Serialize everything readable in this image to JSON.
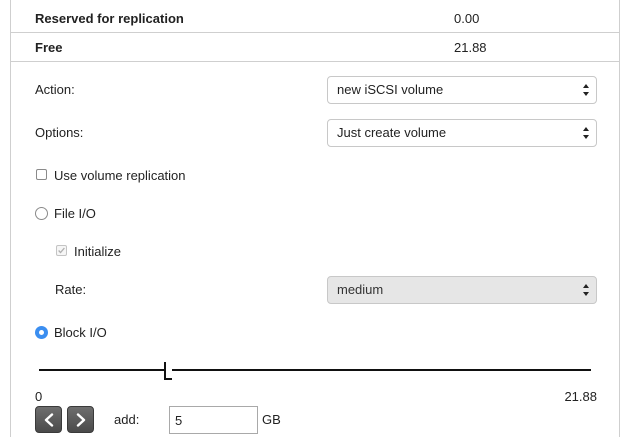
{
  "summary": {
    "reserved_label": "Reserved for replication",
    "reserved_value": "0.00",
    "free_label": "Free",
    "free_value": "21.88"
  },
  "form": {
    "action_label": "Action:",
    "action_value": "new iSCSI volume",
    "options_label": "Options:",
    "options_value": "Just create volume",
    "use_replication_label": "Use volume replication",
    "use_replication_checked": false,
    "file_io_label": "File I/O",
    "file_io_selected": false,
    "initialize_label": "Initialize",
    "initialize_checked": true,
    "rate_label": "Rate:",
    "rate_value": "medium",
    "block_io_label": "Block I/O",
    "block_io_selected": true
  },
  "size_slider": {
    "min_label": "0",
    "max_label": "21.88",
    "value": 5,
    "min": 0,
    "max": 21.88
  },
  "adjust": {
    "add_label": "add:",
    "add_value": "5",
    "unit_label": "GB"
  },
  "icons": {
    "select_arrows": "updown-arrows-icon",
    "prev": "chevron-left-icon",
    "next": "chevron-right-icon",
    "check": "checkmark-icon"
  },
  "colors": {
    "accent": "#3b8ef0",
    "border": "#cfcfcf",
    "disabled_bg": "#e6e6e6",
    "button_dark": "#5a5a5a"
  }
}
